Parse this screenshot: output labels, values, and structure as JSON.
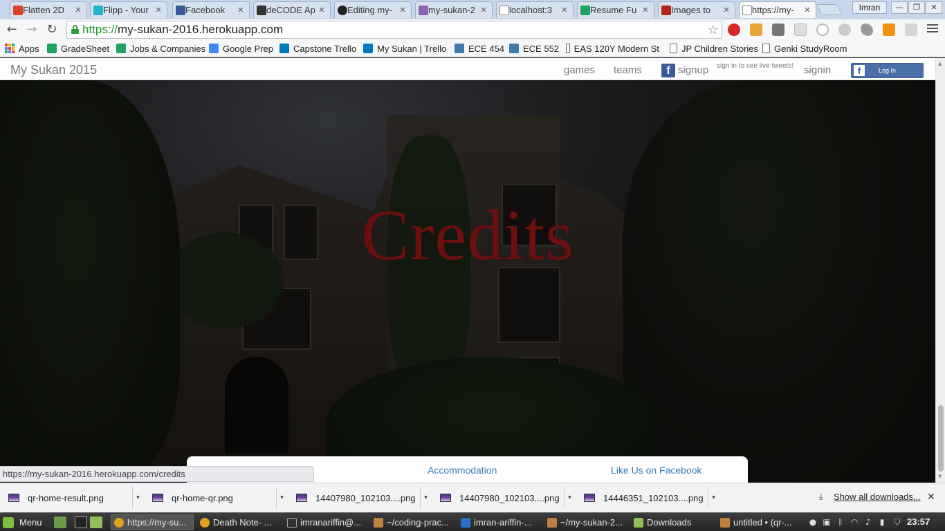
{
  "browser": {
    "tabs": [
      {
        "title": "Flatten 2D",
        "favicon_color": "#e04030"
      },
      {
        "title": "Flipp - Your",
        "favicon_color": "#22b5c9"
      },
      {
        "title": "Facebook",
        "favicon_color": "#3b5998"
      },
      {
        "title": "deCODE Ap",
        "favicon_color": "#333333"
      },
      {
        "title": "Editing my-",
        "favicon_color": "#222222"
      },
      {
        "title": "my-sukan-2",
        "favicon_color": "#8a63b5"
      },
      {
        "title": "localhost:3",
        "favicon_color": "#ffffff"
      },
      {
        "title": "Resume Fu",
        "favicon_color": "#1fa463"
      },
      {
        "title": "Images to",
        "favicon_color": "#b3261e"
      },
      {
        "title": "https://my-",
        "favicon_color": "#ffffff"
      }
    ],
    "user_name": "Imran",
    "address": {
      "scheme": "https://",
      "host": "my-sukan-2016.herokuapp.com"
    },
    "bookmarks": [
      {
        "label": "Apps",
        "icon": "apps-grid-icon"
      },
      {
        "label": "GradeSheet",
        "icon": "sheets-icon"
      },
      {
        "label": "Jobs & Companies",
        "icon": "sheets-icon"
      },
      {
        "label": "Google Prep",
        "icon": "docs-icon"
      },
      {
        "label": "Capstone Trello",
        "icon": "trello-icon"
      },
      {
        "label": "My Sukan | Trello",
        "icon": "trello-icon"
      },
      {
        "label": "ECE 454",
        "icon": "piazza-icon"
      },
      {
        "label": "ECE 552",
        "icon": "piazza-icon"
      },
      {
        "label": "EAS 120Y Modern St",
        "icon": "page-icon"
      },
      {
        "label": "JP Children Stories",
        "icon": "page-icon"
      },
      {
        "label": "Genki StudyRoom",
        "icon": "page-icon"
      }
    ],
    "status_url": "https://my-sukan-2016.herokuapp.com/credits"
  },
  "site": {
    "brand": "My Sukan 2015",
    "nav": {
      "games": "games",
      "teams": "teams",
      "signup": "signup",
      "signin": "signin"
    },
    "tweet_note": "sign in to see live tweets!",
    "fb_login": "Log In",
    "hero_title": "Credits",
    "footer_links": [
      "Accommodation",
      "Like Us on Facebook"
    ]
  },
  "downloads": {
    "items": [
      "qr-home-result.png",
      "qr-home-qr.png",
      "14407980_102103....png",
      "14407980_102103....png",
      "14446351_102103....png"
    ],
    "show_all": "Show all downloads..."
  },
  "taskbar": {
    "menu": "Menu",
    "tasks": [
      {
        "label": "https://my-su...",
        "icon_color": "#e0a020",
        "active": true
      },
      {
        "label": "Death Note- ...",
        "icon_color": "#e0a020",
        "active": false
      },
      {
        "label": "imranariffin@...",
        "icon_color": "#333333",
        "active": false
      },
      {
        "label": "~/coding-prac...",
        "icon_color": "#c08040",
        "active": false
      },
      {
        "label": "imran-ariffin-...",
        "icon_color": "#2a6fc9",
        "active": false
      },
      {
        "label": "~/my-sukan-2...",
        "icon_color": "#c08040",
        "active": false
      },
      {
        "label": "Downloads",
        "icon_color": "#8fbf5a",
        "active": false
      },
      {
        "label": "untitled • (qr-...",
        "icon_color": "#c08040",
        "active": false
      }
    ],
    "clock": "23:57"
  },
  "colors": {
    "hero_title": "#6b0f0f",
    "link": "#337ab7",
    "facebook": "#3b5998",
    "secure_green": "#1e9a2e"
  }
}
